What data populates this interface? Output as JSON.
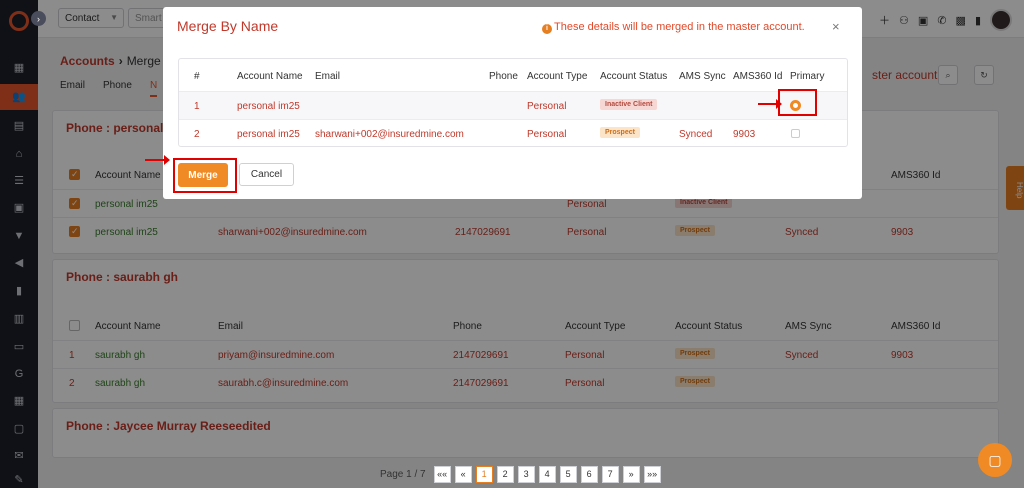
{
  "topbar": {
    "search_type": "Contact",
    "search_placeholder": "Smart"
  },
  "page": {
    "crumb_root": "Accounts",
    "crumb_sub": "Merge A",
    "tabs": [
      "Email",
      "Phone",
      "N"
    ],
    "master_note": "ster account.",
    "help_label": "Help"
  },
  "groups": [
    {
      "title": "Phone : personal i",
      "columns": [
        "Account Name",
        "",
        "",
        "",
        "",
        "",
        "AMS360 Id"
      ],
      "rows": [
        {
          "name": "personal im25",
          "email": "",
          "phone": "",
          "type": "Personal",
          "status": "Inactive Client",
          "sync": "",
          "ams_id": ""
        },
        {
          "name": "personal im25",
          "email": "sharwani+002@insuredmine.com",
          "phone": "2147029691",
          "type": "Personal",
          "status": "Prospect",
          "sync": "Synced",
          "ams_id": "9903"
        }
      ]
    },
    {
      "title": "Phone : saurabh gh",
      "columns": [
        "Account Name",
        "Email",
        "Phone",
        "Account Type",
        "Account Status",
        "AMS Sync",
        "AMS360 Id"
      ],
      "rows": [
        {
          "idx": "1",
          "name": "saurabh gh",
          "email": "priyam@insuredmine.com",
          "phone": "2147029691",
          "type": "Personal",
          "status": "Prospect",
          "sync": "Synced",
          "ams_id": "9903"
        },
        {
          "idx": "2",
          "name": "saurabh gh",
          "email": "saurabh.c@insuredmine.com",
          "phone": "2147029691",
          "type": "Personal",
          "status": "Prospect",
          "sync": "",
          "ams_id": ""
        }
      ]
    },
    {
      "title": "Phone : Jaycee Murray Reeseedited"
    }
  ],
  "pager": {
    "label": "Page 1 / 7",
    "first": "««",
    "prev": "«",
    "pages": [
      "1",
      "2",
      "3",
      "4",
      "5",
      "6",
      "7"
    ],
    "next": "»",
    "last": "»»"
  },
  "modal": {
    "title": "Merge By Name",
    "note": "These details will be merged in the master account.",
    "info_glyph": "i",
    "close_glyph": "×",
    "columns": {
      "idx": "#",
      "name": "Account Name",
      "email": "Email",
      "phone": "Phone",
      "type": "Account Type",
      "status": "Account Status",
      "sync": "AMS Sync",
      "ams_id": "AMS360 Id",
      "primary": "Primary"
    },
    "rows": [
      {
        "idx": "1",
        "name": "personal im25",
        "email": "",
        "phone": "",
        "type": "Personal",
        "status": "Inactive Client",
        "sync": "",
        "ams_id": "",
        "primary": true
      },
      {
        "idx": "2",
        "name": "personal im25",
        "email": "sharwani+002@insuredmine.com",
        "phone": "",
        "type": "Personal",
        "status": "Prospect",
        "sync": "Synced",
        "ams_id": "9903",
        "primary": false
      }
    ],
    "merge_label": "Merge",
    "cancel_label": "Cancel"
  },
  "colors": {
    "accent": "#f08a24",
    "title_red": "#c0392b",
    "annotation_red": "#e00000",
    "rail": "#1d1f2b"
  }
}
